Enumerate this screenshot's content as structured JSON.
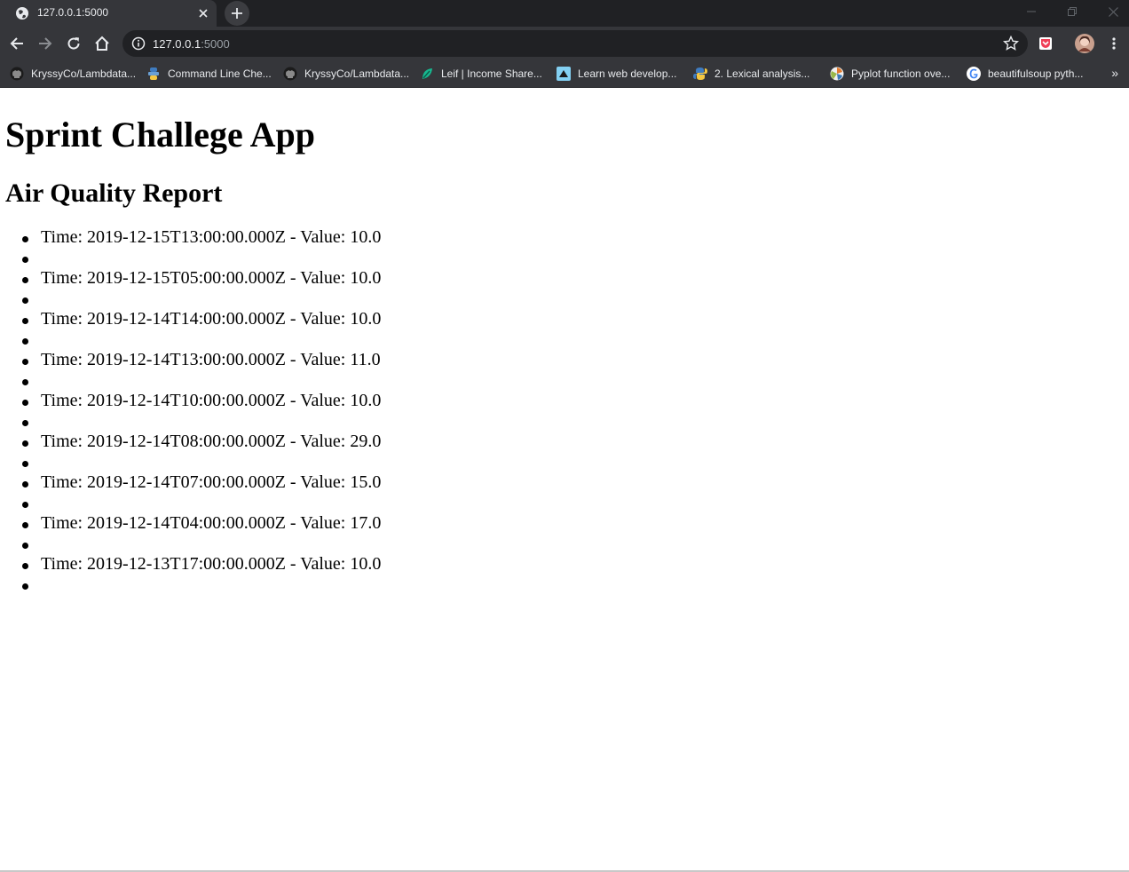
{
  "browser": {
    "tab_title": "127.0.0.1:5000",
    "url_host": "127.0.0.1",
    "url_port": ":5000",
    "bookmarks": [
      {
        "label": "KryssyCo/Lambdata...",
        "icon": "github-icon"
      },
      {
        "label": "Command Line Che...",
        "icon": "python-snake-icon"
      },
      {
        "label": "KryssyCo/Lambdata...",
        "icon": "github-icon"
      },
      {
        "label": "Leif | Income Share...",
        "icon": "leif-icon"
      },
      {
        "label": "Learn web develop...",
        "icon": "mdn-icon"
      },
      {
        "label": "2. Lexical analysis...",
        "icon": "python-icon"
      },
      {
        "label": "Pyplot function ove...",
        "icon": "matplotlib-icon"
      },
      {
        "label": "beautifulsoup pyth...",
        "icon": "google-icon"
      }
    ],
    "bookmarks_overflow": "»"
  },
  "page": {
    "title": "Sprint Challege App",
    "subtitle": "Air Quality Report",
    "readings": [
      {
        "text": "Time: 2019-12-15T13:00:00.000Z - Value: 10.0"
      },
      {
        "text": ""
      },
      {
        "text": "Time: 2019-12-15T05:00:00.000Z - Value: 10.0"
      },
      {
        "text": ""
      },
      {
        "text": "Time: 2019-12-14T14:00:00.000Z - Value: 10.0"
      },
      {
        "text": ""
      },
      {
        "text": "Time: 2019-12-14T13:00:00.000Z - Value: 11.0"
      },
      {
        "text": ""
      },
      {
        "text": "Time: 2019-12-14T10:00:00.000Z - Value: 10.0"
      },
      {
        "text": ""
      },
      {
        "text": "Time: 2019-12-14T08:00:00.000Z - Value: 29.0"
      },
      {
        "text": ""
      },
      {
        "text": "Time: 2019-12-14T07:00:00.000Z - Value: 15.0"
      },
      {
        "text": ""
      },
      {
        "text": "Time: 2019-12-14T04:00:00.000Z - Value: 17.0"
      },
      {
        "text": ""
      },
      {
        "text": "Time: 2019-12-13T17:00:00.000Z - Value: 10.0"
      },
      {
        "text": ""
      }
    ]
  }
}
